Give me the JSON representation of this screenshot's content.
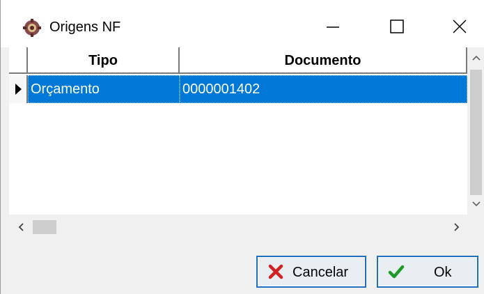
{
  "window": {
    "title": "Origens NF",
    "app_icon": "gear-app-icon",
    "controls": [
      "minimize-icon",
      "maximize-icon",
      "close-icon"
    ]
  },
  "grid": {
    "columns": [
      "Tipo",
      "Documento"
    ],
    "rows": [
      {
        "tipo": "Orçamento",
        "documento": "0000001402",
        "selected": true
      }
    ],
    "selection_color": "#0078d7"
  },
  "buttons": {
    "cancel_label": "Cancelar",
    "cancel_icon": "x-icon",
    "ok_label": "Ok",
    "ok_icon": "checkmark-icon"
  }
}
